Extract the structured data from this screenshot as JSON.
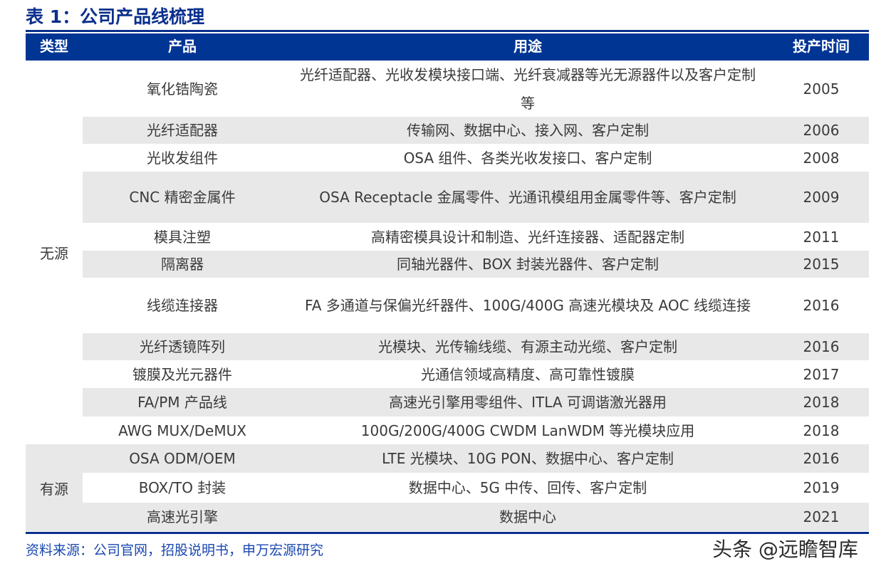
{
  "title": "表 1：公司产品线梳理",
  "header": {
    "type": "类型",
    "product": "产品",
    "use": "用途",
    "year": "投产时间"
  },
  "colors": {
    "header_bg": "#003594",
    "title": "#0a2f8c",
    "shade": "#e8e8e8",
    "source_text": "#1a48b0"
  },
  "groups": [
    {
      "label": "无源",
      "rows": 11
    },
    {
      "label": "有源",
      "rows": 3
    }
  ],
  "rows": [
    {
      "product": "氧化锆陶瓷",
      "use": "光纤适配器、光收发模块接口端、光纤衰减器等光无源器件以及客户定制等",
      "year": "2005"
    },
    {
      "product": "光纤适配器",
      "use": "传输网、数据中心、接入网、客户定制",
      "year": "2006"
    },
    {
      "product": "光收发组件",
      "use": "OSA 组件、各类光收发接口、客户定制",
      "year": "2008"
    },
    {
      "product": "CNC 精密金属件",
      "use": "OSA Receptacle 金属零件、光通讯模组用金属零件等、客户定制",
      "year": "2009"
    },
    {
      "product": "模具注塑",
      "use": "高精密模具设计和制造、光纤连接器、适配器定制",
      "year": "2011"
    },
    {
      "product": "隔离器",
      "use": "同轴光器件、BOX 封装光器件、客户定制",
      "year": "2015"
    },
    {
      "product": "线缆连接器",
      "use": "FA 多通道与保偏光纤器件、100G/400G 高速光模块及 AOC 线缆连接",
      "year": "2016"
    },
    {
      "product": "光纤透镜阵列",
      "use": "光模块、光传输线缆、有源主动光缆、客户定制",
      "year": "2016"
    },
    {
      "product": "镀膜及光元器件",
      "use": "光通信领域高精度、高可靠性镀膜",
      "year": "2017"
    },
    {
      "product": "FA/PM 产品线",
      "use": "高速光引擎用零组件、ITLA 可调谐激光器用",
      "year": "2018"
    },
    {
      "product": "AWG MUX/DeMUX",
      "use": "100G/200G/400G CWDM LanWDM 等光模块应用",
      "year": "2018"
    },
    {
      "product": "OSA ODM/OEM",
      "use": "LTE 光模块、10G PON、数据中心、客户定制",
      "year": "2016"
    },
    {
      "product": "BOX/TO 封装",
      "use": "数据中心、5G 中传、回传、客户定制",
      "year": "2019"
    },
    {
      "product": "高速光引擎",
      "use": "数据中心",
      "year": "2021"
    }
  ],
  "source": "资料来源：公司官网，招股说明书，申万宏源研究",
  "watermark": "头条 @远瞻智库"
}
